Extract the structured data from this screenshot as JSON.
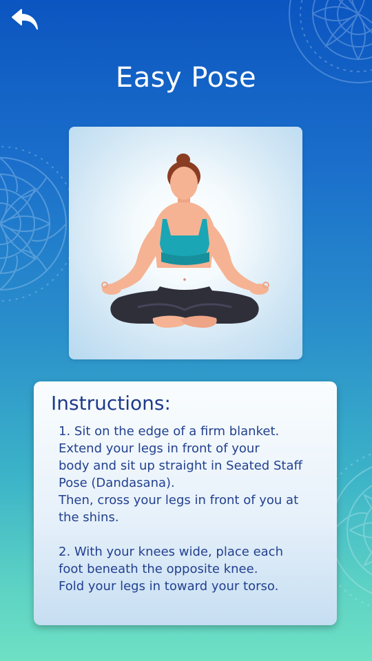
{
  "header": {
    "back_icon": "back-arrow-icon",
    "title": "Easy Pose"
  },
  "pose_image": {
    "icon": "easy-pose-illustration"
  },
  "instructions": {
    "heading": "Instructions:",
    "step1_lines": [
      "1. Sit on the edge of a firm blanket.",
      "Extend your legs in front of your",
      "body and sit up straight in Seated Staff",
      "Pose (Dandasana).",
      "Then, cross your legs in front of you at",
      "the shins."
    ],
    "step2_lines": [
      "2. With your knees wide, place each",
      "foot beneath the opposite knee.",
      "Fold your legs in toward your torso."
    ]
  },
  "colors": {
    "background_top": "#0b55c0",
    "background_bottom": "#6ee0c4",
    "heading_text": "#1e3a8a",
    "body_text": "#22408f",
    "top_color": "#1aa6b4",
    "pants_color": "#2f2f3a",
    "skin_color": "#f5b393",
    "hair_color": "#8a3d22"
  }
}
